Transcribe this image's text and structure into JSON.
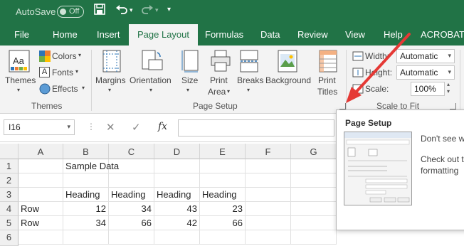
{
  "titlebar": {
    "autosave_label": "AutoSave",
    "autosave_state": "Off",
    "quick_access": [
      "save-icon",
      "undo-icon",
      "redo-icon",
      "customize-icon"
    ]
  },
  "tabs": [
    "File",
    "Home",
    "Insert",
    "Page Layout",
    "Formulas",
    "Data",
    "Review",
    "View",
    "Help",
    "ACROBAT"
  ],
  "active_tab": "Page Layout",
  "ribbon": {
    "themes_group": {
      "label": "Themes",
      "themes_button": "Themes",
      "colors": "Colors",
      "fonts": "Fonts",
      "effects": "Effects"
    },
    "page_setup_group": {
      "label": "Page Setup",
      "margins": "Margins",
      "orientation": "Orientation",
      "size": "Size",
      "print_area_1": "Print",
      "print_area_2": "Area",
      "breaks": "Breaks",
      "background": "Background",
      "print_titles_1": "Print",
      "print_titles_2": "Titles"
    },
    "scale_group": {
      "label": "Scale to Fit",
      "width_label": "Width:",
      "width_value": "Automatic",
      "height_label": "Height:",
      "height_value": "Automatic",
      "scale_label": "Scale:",
      "scale_value": "100%"
    }
  },
  "formula_bar": {
    "name_box": "I16",
    "cancel": "✕",
    "enter": "✓",
    "fx": "fx"
  },
  "sheet": {
    "columns": [
      "A",
      "B",
      "C",
      "D",
      "E",
      "F",
      "G"
    ],
    "rows": [
      "1",
      "2",
      "3",
      "4",
      "5",
      "6"
    ],
    "b1": "Sample Data",
    "headings": [
      "Heading",
      "Heading",
      "Heading",
      "Heading"
    ],
    "row4": {
      "label": "Row",
      "values": [
        "12",
        "34",
        "43",
        "23"
      ]
    },
    "row5": {
      "label": "Row",
      "values": [
        "34",
        "66",
        "42",
        "66"
      ]
    }
  },
  "tooltip": {
    "title": "Page Setup",
    "line1": "Don't see w",
    "line2": "Check out t",
    "line3": "formatting"
  },
  "colors": {
    "excel_green": "#217346",
    "annotation_red": "#e53935"
  }
}
